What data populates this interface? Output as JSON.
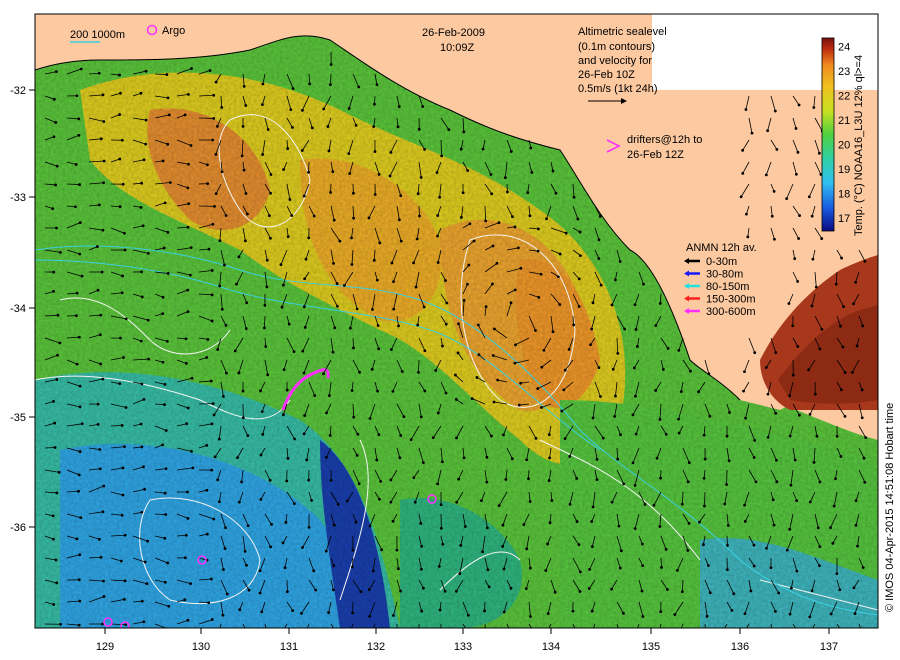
{
  "title": {
    "date": "26-Feb-2009",
    "time": "10:09Z"
  },
  "scale": {
    "depth_labels": "200  1000m",
    "argo_label": "Argo"
  },
  "sealevel_note": [
    "Altimetric sealevel",
    "(0.1m contours)",
    "and velocity for",
    "26-Feb 10Z",
    "0.5m/s (1kt 24h)"
  ],
  "drifters_note": [
    "drifters@12h to",
    "26-Feb 12Z"
  ],
  "anmn_legend": {
    "title": "ANMN 12h av.",
    "items": [
      {
        "label": "0-30m",
        "color": "#000000"
      },
      {
        "label": "30-80m",
        "color": "#1a1aff"
      },
      {
        "label": "80-150m",
        "color": "#22e0e0"
      },
      {
        "label": "150-300m",
        "color": "#ff2020"
      },
      {
        "label": "300-600m",
        "color": "#ff30ff"
      }
    ]
  },
  "colorbar": {
    "label": "Temp. (°C) NOAA16_L3U 12% ql>=4",
    "ticks": [
      "17",
      "18",
      "19",
      "20",
      "21",
      "22",
      "23",
      "24"
    ]
  },
  "axes": {
    "x_ticks": [
      "129",
      "130",
      "131",
      "132",
      "133",
      "134",
      "135",
      "136",
      "137"
    ],
    "y_ticks": [
      "-32",
      "-33",
      "-34",
      "-35",
      "-36"
    ]
  },
  "credit": "© IMOS 04-Apr-2015 14:51:08 Hobart time",
  "colors": {
    "land": "#fcc9a0",
    "ocean_warm": "#f0a830",
    "ocean_mid": "#60d040",
    "ocean_cool": "#30b0e0",
    "ocean_cold": "#1030a0"
  }
}
